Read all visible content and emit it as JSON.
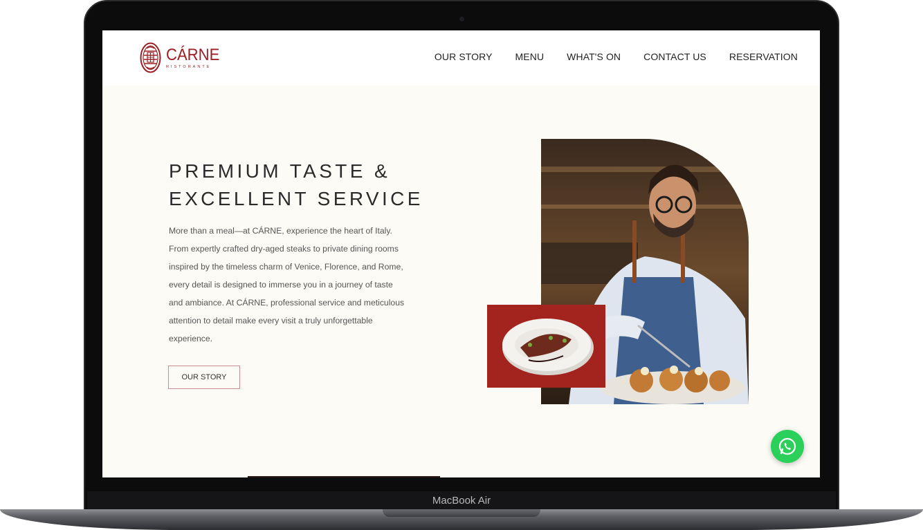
{
  "device": {
    "label": "MacBook Air"
  },
  "header": {
    "logo": {
      "name": "CÁRNE",
      "subtitle": "RISTORANTE",
      "icon": "crest-logo-icon",
      "color": "#9b1f24"
    },
    "nav": [
      {
        "label": "OUR STORY"
      },
      {
        "label": "MENU"
      },
      {
        "label": "WHAT'S ON"
      },
      {
        "label": "CONTACT US"
      },
      {
        "label": "RESERVATION"
      }
    ]
  },
  "hero": {
    "title_line1": "PREMIUM TASTE &",
    "title_line2": "EXCELLENT SERVICE",
    "body": "More than a meal—at CÁRNE, experience the heart of Italy. From expertly crafted dry-aged steaks to private dining rooms inspired by the timeless charm of Venice, Florence, and Rome, every detail is designed to immerse you in a journey of taste and ambiance. At CÁRNE, professional service and meticulous attention to detail make every visit a truly unforgettable experience.",
    "cta_label": "OUR STORY"
  },
  "images": {
    "chef": "chef-plating-photo",
    "dish": "plated-dish-photo"
  },
  "chat": {
    "icon": "whatsapp-icon",
    "color": "#2ad05a"
  }
}
